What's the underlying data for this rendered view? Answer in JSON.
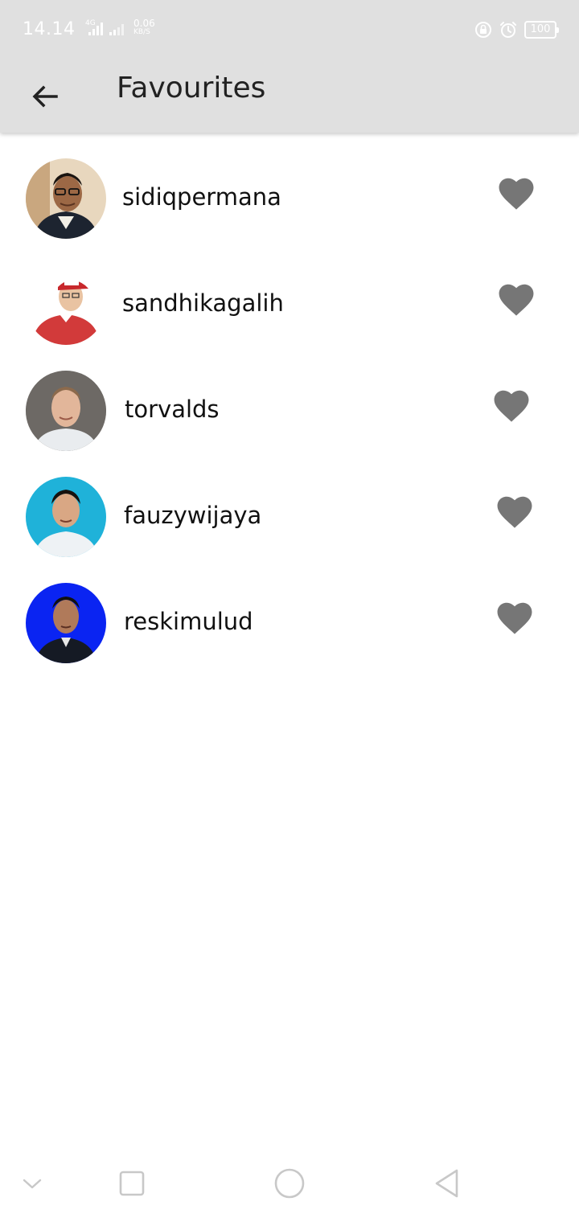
{
  "status_bar": {
    "time": "14.14",
    "network": "4G",
    "speed_value": "0.06",
    "speed_unit": "KB/S",
    "battery": "100"
  },
  "app_bar": {
    "title": "Favourites",
    "back_icon": "arrow-back-icon"
  },
  "favourites": [
    {
      "username": "sidiqpermana",
      "favourite_icon": "heart-icon",
      "favourited": true
    },
    {
      "username": "sandhikagalih",
      "favourite_icon": "heart-icon",
      "favourited": true
    },
    {
      "username": "torvalds",
      "favourite_icon": "heart-icon",
      "favourited": true
    },
    {
      "username": "fauzywijaya",
      "favourite_icon": "heart-icon",
      "favourited": true
    },
    {
      "username": "reskimulud",
      "favourite_icon": "heart-icon",
      "favourited": true
    }
  ],
  "nav_bar": {
    "buttons": [
      "chevron-down-icon",
      "square-recents-icon",
      "circle-home-icon",
      "triangle-back-icon"
    ]
  },
  "colors": {
    "app_bar_bg": "#e0e0e0",
    "heart": "#767676",
    "text": "#111111",
    "nav_icon": "#c8c8c8"
  }
}
